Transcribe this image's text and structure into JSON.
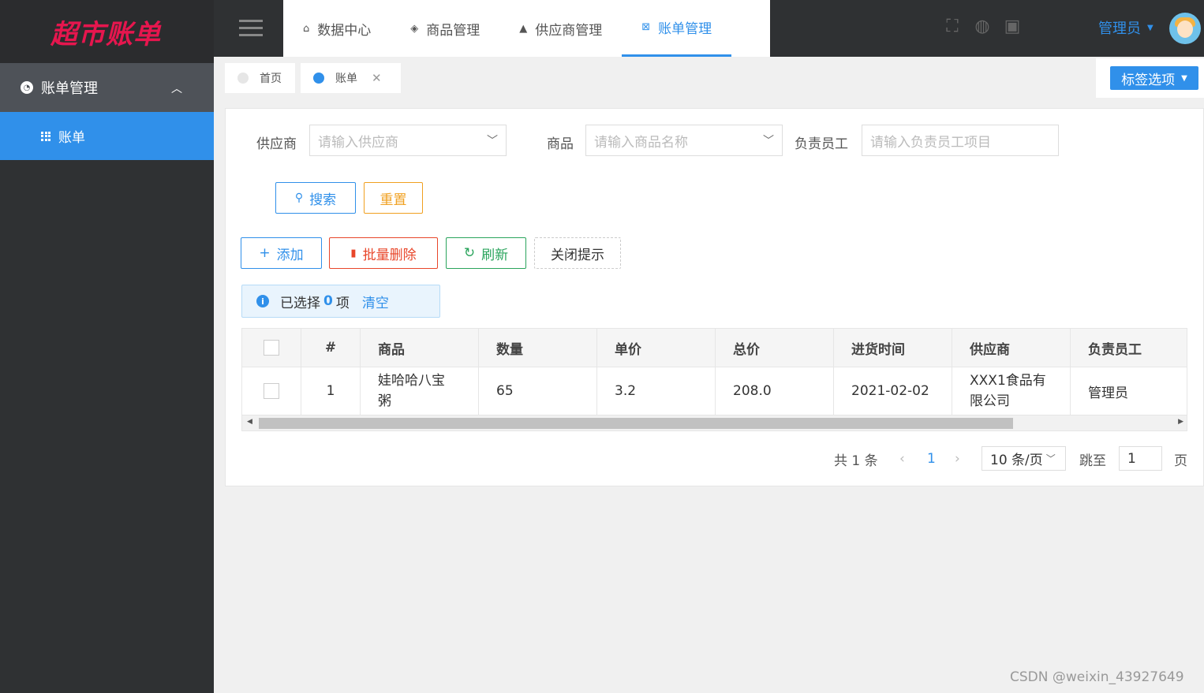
{
  "app": {
    "logo_text": "超市账单"
  },
  "sidebar": {
    "group": {
      "label": "账单管理"
    },
    "items": [
      {
        "label": "账单"
      }
    ]
  },
  "header": {
    "tabs": [
      {
        "label": "数据中心",
        "icon": "home-icon"
      },
      {
        "label": "商品管理",
        "icon": "tag-icon"
      },
      {
        "label": "供应商管理",
        "icon": "user-icon"
      },
      {
        "label": "账单管理",
        "icon": "bill-icon",
        "active": true
      }
    ],
    "user": "管理员"
  },
  "page_tabs": [
    {
      "label": "首页"
    },
    {
      "label": "账单",
      "active": true
    }
  ],
  "tag_options_label": "标签选项",
  "filters": {
    "supplier": {
      "label": "供应商",
      "placeholder": "请输入供应商"
    },
    "product": {
      "label": "商品",
      "placeholder": "请输入商品名称"
    },
    "staff": {
      "label": "负责员工",
      "placeholder": "请输入负责员工项目"
    }
  },
  "buttons": {
    "search": "搜索",
    "reset": "重置",
    "add": "添加",
    "batch_delete": "批量删除",
    "refresh": "刷新",
    "close_tip": "关闭提示"
  },
  "selection": {
    "prefix": "已选择",
    "count": "0",
    "suffix": "项",
    "clear": "清空"
  },
  "table": {
    "columns": [
      "#",
      "商品",
      "数量",
      "单价",
      "总价",
      "进货时间",
      "供应商",
      "负责员工"
    ],
    "rows": [
      {
        "index": "1",
        "product": "娃哈哈八宝粥",
        "qty": "65",
        "price": "3.2",
        "total": "208.0",
        "date": "2021-02-02",
        "supplier": "XXX1食品有限公司",
        "staff": "管理员"
      }
    ]
  },
  "pagination": {
    "total": "共 1 条",
    "current": "1",
    "page_size": "10 条/页",
    "jump_label": "跳至",
    "jump_value": "1",
    "page_suffix": "页"
  },
  "watermark": "CSDN @weixin_43927649",
  "colors": {
    "accent": "#3090ea",
    "sidebar": "#2f3133",
    "logo": "#e6164e",
    "danger": "#e8462a",
    "warning": "#f0a020",
    "success": "#2aa45c"
  }
}
